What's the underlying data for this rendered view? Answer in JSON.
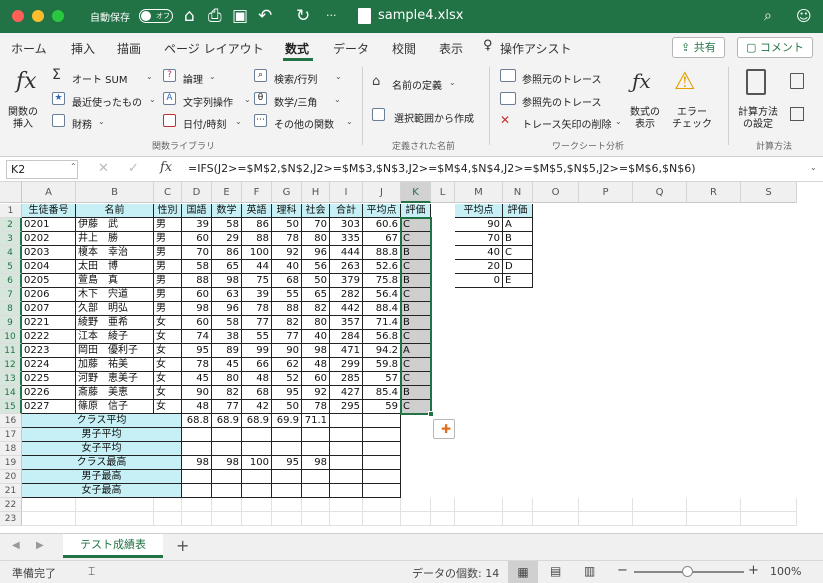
{
  "title_bar": {
    "autosave_label": "自動保存",
    "autosave_state": "オフ",
    "filename": "sample4.xlsx"
  },
  "tabs": [
    "ホーム",
    "挿入",
    "描画",
    "ページ レイアウト",
    "数式",
    "データ",
    "校閲",
    "表示",
    "操作アシスト"
  ],
  "active_tab": "数式",
  "share_label": "共有",
  "comment_label": "コメント",
  "ribbon": {
    "insert_function": "関数の\n挿入",
    "autosum": "オート SUM",
    "recent": "最近使ったもの",
    "financial": "財務",
    "logical": "論理",
    "text": "文字列操作",
    "datetime": "日付/時刻",
    "lookup": "検索/行列",
    "math": "数学/三角",
    "more": "その他の関数",
    "group_function_library": "関数ライブラリ",
    "define_name": "名前の定義",
    "create_from_selection": "選択範囲から作成",
    "group_defined_names": "定義された名前",
    "trace_precedents": "参照元のトレース",
    "trace_dependents": "参照先のトレース",
    "remove_arrows": "トレース矢印の削除",
    "show_formulas": "数式の\n表示",
    "error_check": "エラー\nチェック",
    "group_formula_auditing": "ワークシート分析",
    "calc_options": "計算方法\nの設定",
    "group_calculation": "計算方法"
  },
  "formula_bar": {
    "name_box": "K2",
    "formula": "=IFS(J2>=$M$2,$N$2,J2>=$M$3,$N$3,J2>=$M$4,$N$4,J2>=$M$5,$N$5,J2>=$M$6,$N$6)"
  },
  "columns": [
    "A",
    "B",
    "C",
    "D",
    "E",
    "F",
    "G",
    "H",
    "I",
    "J",
    "K",
    "L",
    "M",
    "N",
    "O",
    "P",
    "Q",
    "R",
    "S"
  ],
  "rows": [
    "1",
    "2",
    "3",
    "4",
    "5",
    "6",
    "7",
    "8",
    "9",
    "10",
    "11",
    "12",
    "13",
    "14",
    "15",
    "16",
    "17",
    "18",
    "19",
    "20",
    "21",
    "22",
    "23"
  ],
  "header_row": [
    "生徒番号",
    "名前",
    "性別",
    "国語",
    "数学",
    "英語",
    "理科",
    "社会",
    "合計",
    "平均点",
    "評価"
  ],
  "students": [
    [
      "0201",
      "伊藤　武",
      "男",
      "39",
      "58",
      "86",
      "50",
      "70",
      "303",
      "60.6",
      "C"
    ],
    [
      "0202",
      "井上　勝",
      "男",
      "60",
      "29",
      "88",
      "78",
      "80",
      "335",
      "67",
      "C"
    ],
    [
      "0203",
      "榎本　幸治",
      "男",
      "70",
      "86",
      "100",
      "92",
      "96",
      "444",
      "88.8",
      "B"
    ],
    [
      "0204",
      "太田　博",
      "男",
      "58",
      "65",
      "44",
      "40",
      "56",
      "263",
      "52.6",
      "C"
    ],
    [
      "0205",
      "萱島　真",
      "男",
      "88",
      "98",
      "75",
      "68",
      "50",
      "379",
      "75.8",
      "B"
    ],
    [
      "0206",
      "木下　宍道",
      "男",
      "60",
      "63",
      "39",
      "55",
      "65",
      "282",
      "56.4",
      "C"
    ],
    [
      "0207",
      "久部　明弘",
      "男",
      "98",
      "96",
      "78",
      "88",
      "82",
      "442",
      "88.4",
      "B"
    ],
    [
      "0221",
      "綾野　亜希",
      "女",
      "60",
      "58",
      "77",
      "82",
      "80",
      "357",
      "71.4",
      "B"
    ],
    [
      "0222",
      "江本　綾子",
      "女",
      "74",
      "38",
      "55",
      "77",
      "40",
      "284",
      "56.8",
      "C"
    ],
    [
      "0223",
      "岡田　優利子",
      "女",
      "95",
      "89",
      "99",
      "90",
      "98",
      "471",
      "94.2",
      "A"
    ],
    [
      "0224",
      "加藤　祐美",
      "女",
      "78",
      "45",
      "66",
      "62",
      "48",
      "299",
      "59.8",
      "C"
    ],
    [
      "0225",
      "河野　恵美子",
      "女",
      "45",
      "80",
      "48",
      "52",
      "60",
      "285",
      "57",
      "C"
    ],
    [
      "0226",
      "斎藤　美恵",
      "女",
      "90",
      "82",
      "68",
      "95",
      "92",
      "427",
      "85.4",
      "B"
    ],
    [
      "0227",
      "篠原　信子",
      "女",
      "48",
      "77",
      "42",
      "50",
      "78",
      "295",
      "59",
      "C"
    ]
  ],
  "summary": [
    {
      "label": "クラス平均",
      "values": [
        "68.8",
        "68.9",
        "68.9",
        "69.9",
        "71.1"
      ]
    },
    {
      "label": "男子平均",
      "values": [
        "",
        "",
        "",
        "",
        ""
      ]
    },
    {
      "label": "女子平均",
      "values": [
        "",
        "",
        "",
        "",
        ""
      ]
    },
    {
      "label": "クラス最高",
      "values": [
        "98",
        "98",
        "100",
        "95",
        "98"
      ]
    },
    {
      "label": "男子最高",
      "values": [
        "",
        "",
        "",
        "",
        ""
      ]
    },
    {
      "label": "女子最高",
      "values": [
        "",
        "",
        "",
        "",
        ""
      ]
    }
  ],
  "grade_table": {
    "headers": [
      "平均点",
      "評価"
    ],
    "rows": [
      [
        "90",
        "A"
      ],
      [
        "70",
        "B"
      ],
      [
        "40",
        "C"
      ],
      [
        "20",
        "D"
      ],
      [
        "0",
        "E"
      ]
    ]
  },
  "sheet_tab": "テスト成績表",
  "status": {
    "ready": "準備完了",
    "count": "データの個数: 14",
    "zoom": "100%"
  },
  "colors": {
    "accent": "#217346",
    "header_fill": "#c6f0f5"
  }
}
